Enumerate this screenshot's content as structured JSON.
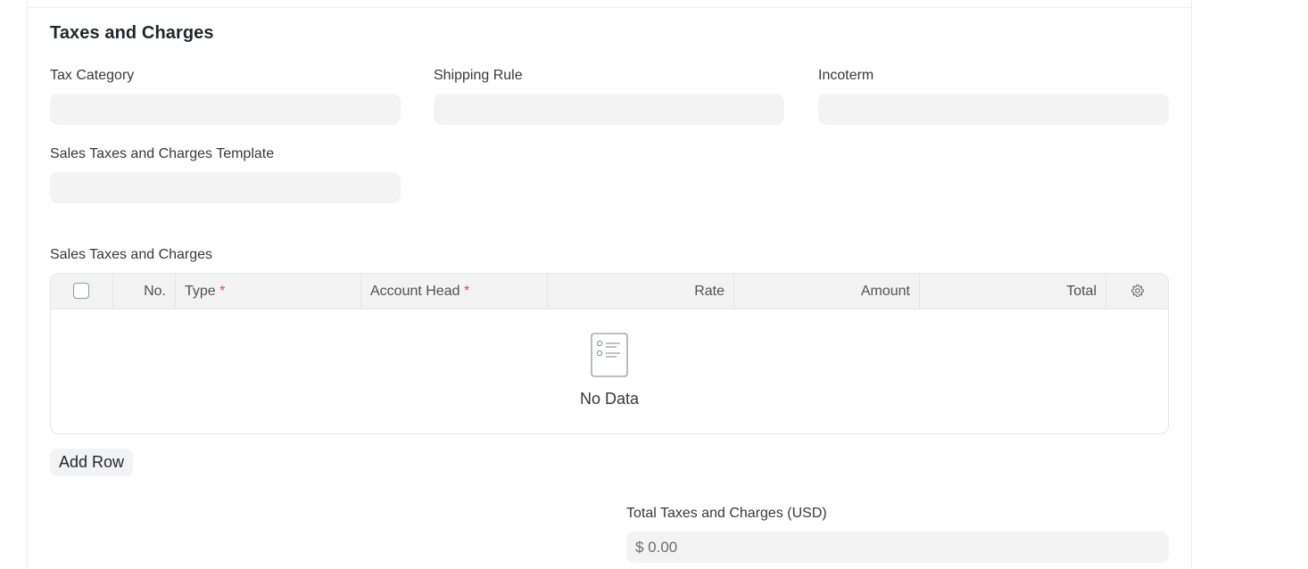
{
  "section": {
    "title": "Taxes and Charges"
  },
  "fields": {
    "tax_category": {
      "label": "Tax Category",
      "value": ""
    },
    "shipping_rule": {
      "label": "Shipping Rule",
      "value": ""
    },
    "incoterm": {
      "label": "Incoterm",
      "value": ""
    },
    "taxes_template": {
      "label": "Sales Taxes and Charges Template",
      "value": ""
    },
    "total_taxes": {
      "label": "Total Taxes and Charges (USD)",
      "value": "$ 0.00"
    }
  },
  "table": {
    "label": "Sales Taxes and Charges",
    "columns": {
      "no": "No.",
      "type": "Type",
      "account_head": "Account Head",
      "rate": "Rate",
      "amount": "Amount",
      "total": "Total"
    },
    "required_mark": "*",
    "empty_text": "No Data",
    "add_row_label": "Add Row"
  },
  "icons": {
    "settings": "gear-icon",
    "empty_state": "list-document-icon",
    "select_all": "checkbox"
  }
}
